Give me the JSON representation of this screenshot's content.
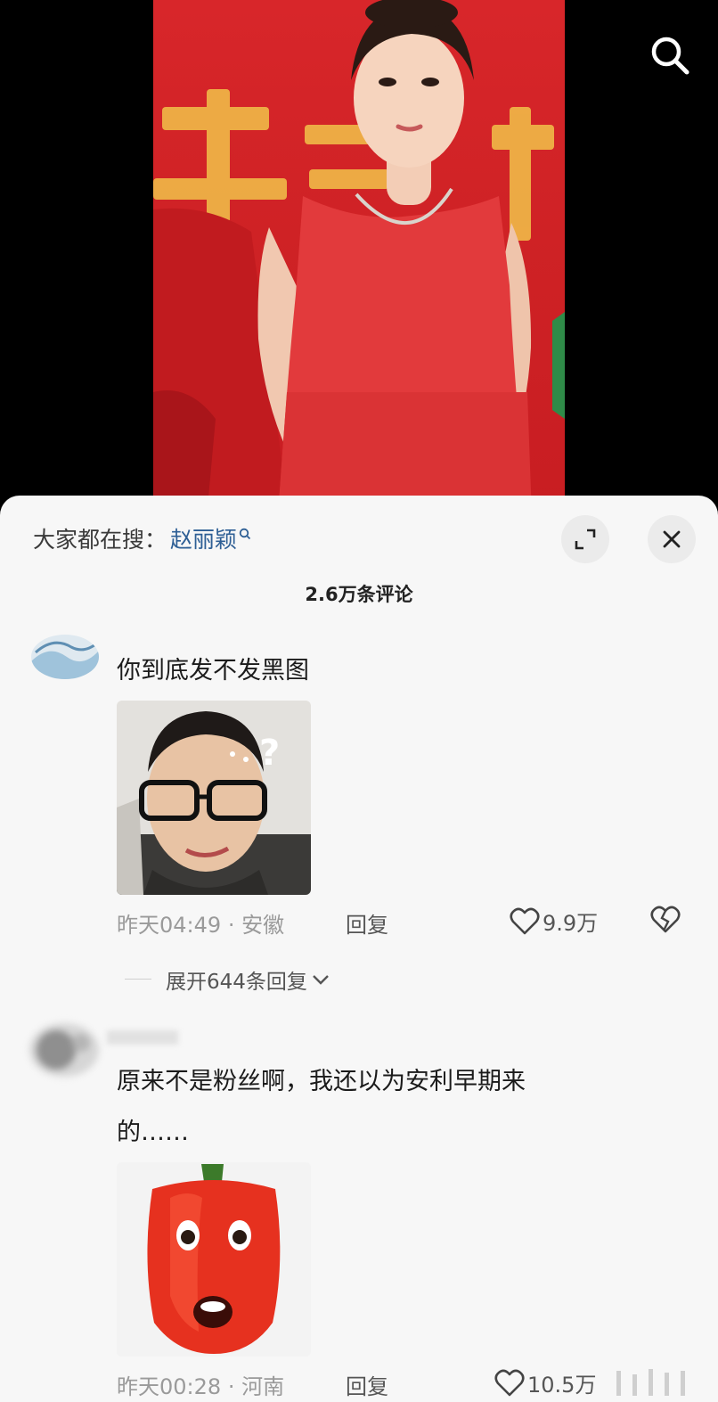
{
  "header": {
    "search_icon": "search-icon"
  },
  "sheet": {
    "hot_search_label": "大家都在搜：",
    "hot_search_keyword": "赵丽颖",
    "expand_icon": "expand-icon",
    "close_icon": "close-icon",
    "comment_count": "2.6万条评论"
  },
  "comments": [
    {
      "text": "你到底发不发黑图",
      "time": "昨天04:49",
      "location": "安徽",
      "reply_label": "回复",
      "likes": "9.9万",
      "expand_replies": "展开644条回复"
    },
    {
      "text_line1": "原来不是粉丝啊，我还以为安利早期来",
      "text_line2": "的……",
      "time": "昨天00:28",
      "location": "河南",
      "reply_label": "回复",
      "likes": "10.5万"
    }
  ],
  "colors": {
    "sheet_bg": "#f7f7f7",
    "keyword": "#2e5f95",
    "meta_gray": "#9a9a9a"
  }
}
